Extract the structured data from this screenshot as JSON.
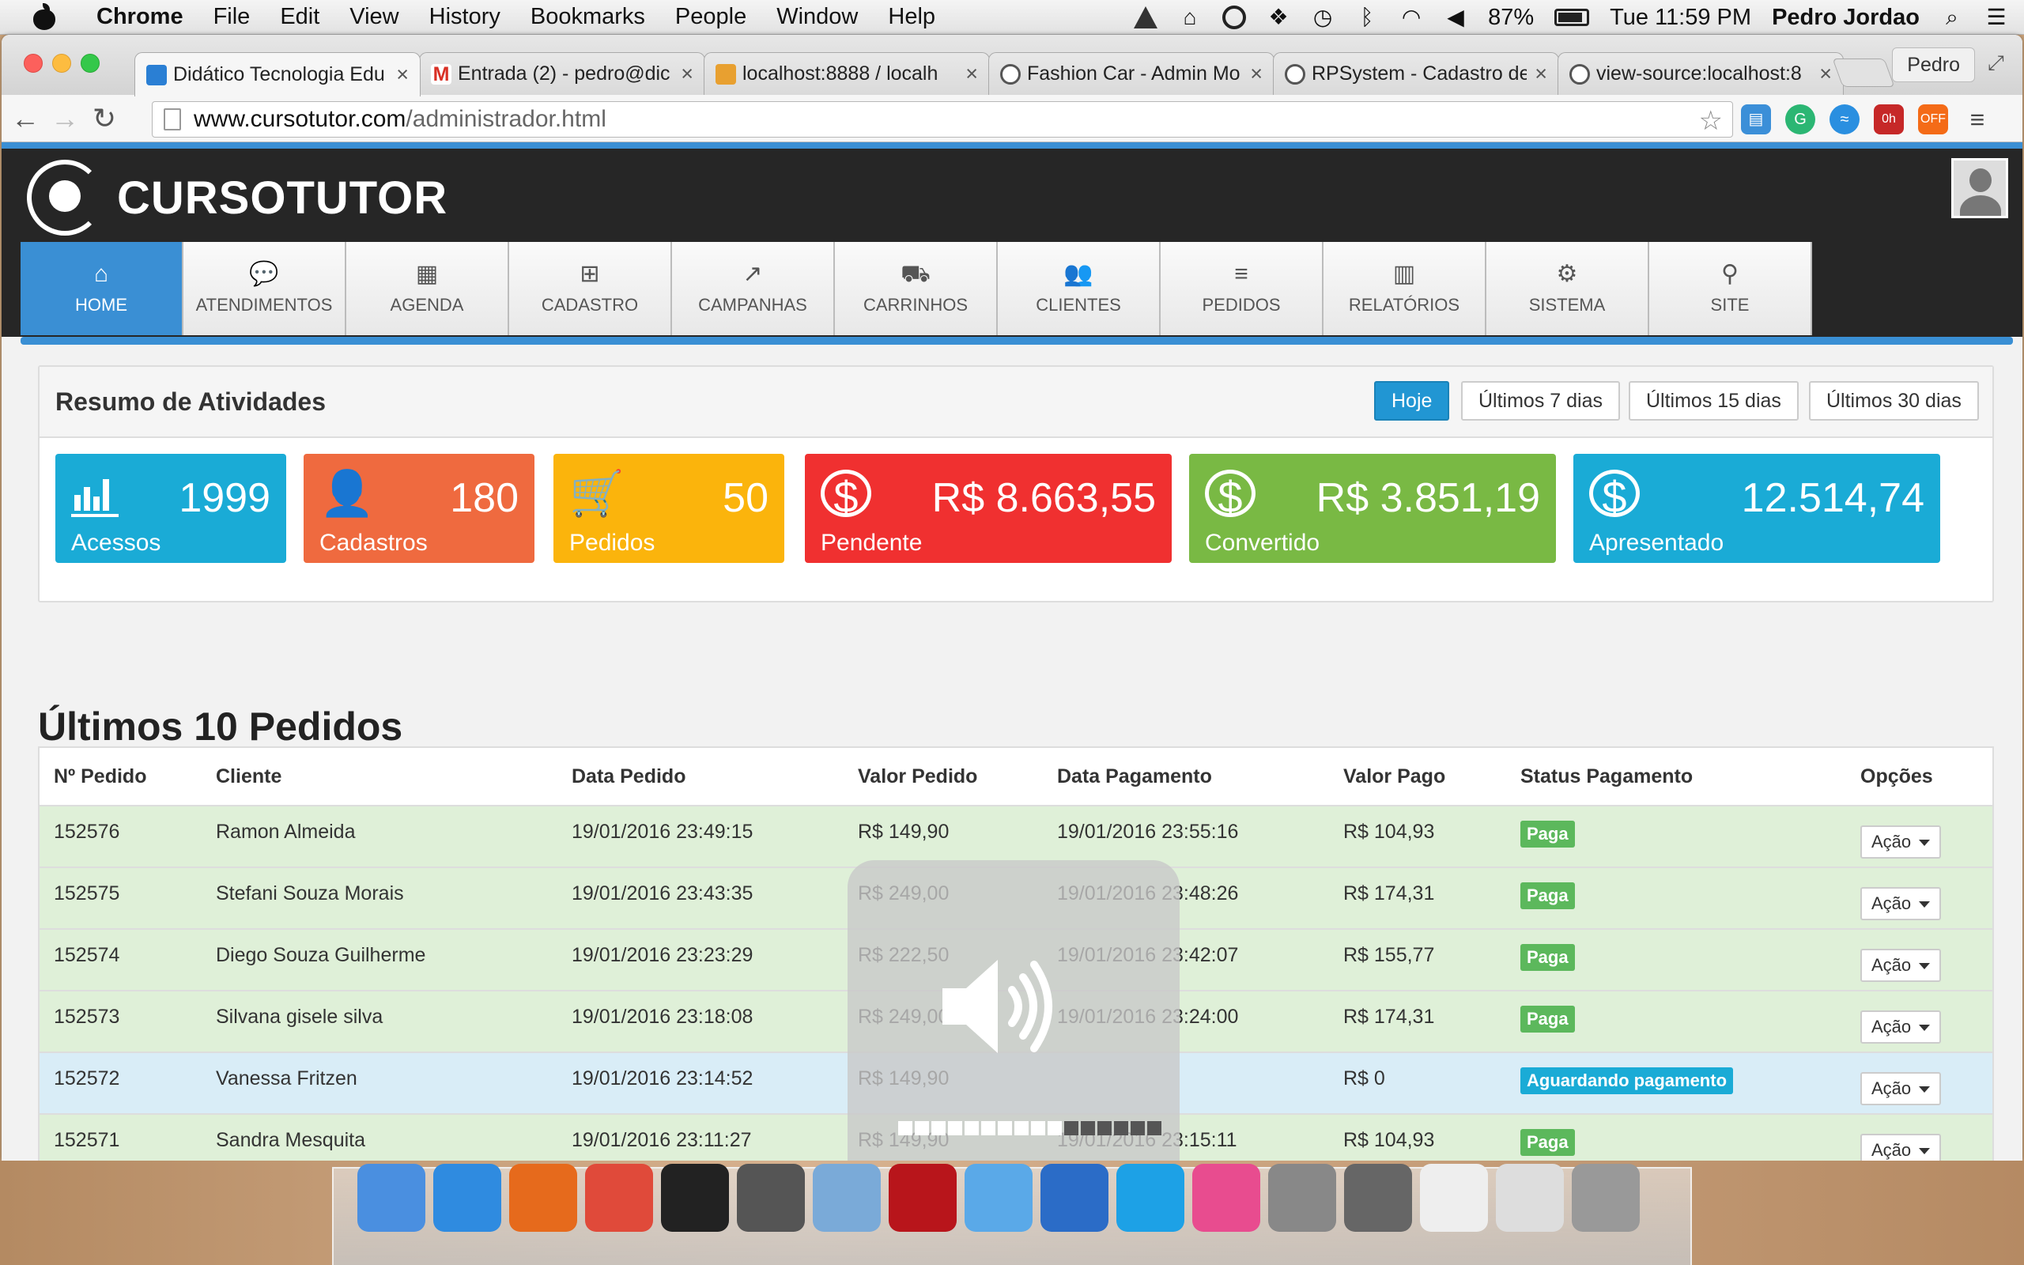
{
  "menubar": {
    "app": "Chrome",
    "items": [
      "File",
      "Edit",
      "View",
      "History",
      "Bookmarks",
      "People",
      "Window",
      "Help"
    ],
    "battery": "87%",
    "clock": "Tue 11:59 PM",
    "user": "Pedro Jordao"
  },
  "browser": {
    "tabs": [
      {
        "title": "Didático Tecnologia Edu"
      },
      {
        "title": "Entrada (2) - pedro@dic"
      },
      {
        "title": "localhost:8888 / localh"
      },
      {
        "title": "Fashion Car - Admin Mo"
      },
      {
        "title": "RPSystem - Cadastro de"
      },
      {
        "title": "view-source:localhost:8"
      }
    ],
    "profile": "Pedro",
    "url_host": "www.cursotutor.com",
    "url_path": "/administrador.html"
  },
  "site": {
    "brand": "CURSOTUTOR",
    "nav": [
      {
        "label": "HOME",
        "icon": "home-icon",
        "glyph": "⌂"
      },
      {
        "label": "ATENDIMENTOS",
        "icon": "chat-icon",
        "glyph": "💬"
      },
      {
        "label": "AGENDA",
        "icon": "calendar-icon",
        "glyph": "▦"
      },
      {
        "label": "CADASTRO",
        "icon": "plus-square-icon",
        "glyph": "⊞"
      },
      {
        "label": "CAMPANHAS",
        "icon": "chart-line-icon",
        "glyph": "↗"
      },
      {
        "label": "CARRINHOS",
        "icon": "cart-icon",
        "glyph": "⛟"
      },
      {
        "label": "CLIENTES",
        "icon": "users-icon",
        "glyph": "👥"
      },
      {
        "label": "PEDIDOS",
        "icon": "list-icon",
        "glyph": "≡"
      },
      {
        "label": "RELATÓRIOS",
        "icon": "bar-chart-icon",
        "glyph": "▥"
      },
      {
        "label": "SISTEMA",
        "icon": "gears-icon",
        "glyph": "⚙"
      },
      {
        "label": "SITE",
        "icon": "map-marker-icon",
        "glyph": "⚲"
      }
    ]
  },
  "resumo": {
    "title": "Resumo de Atividades",
    "filters": [
      "Hoje",
      "Últimos 7 dias",
      "Últimos 15 dias",
      "Últimos 30 dias"
    ],
    "cards": [
      {
        "value": "1999",
        "label": "Acessos",
        "color": "#1aabd6",
        "icon": "bar-chart-icon"
      },
      {
        "value": "180",
        "label": "Cadastros",
        "color": "#ef6a3f",
        "icon": "user-icon"
      },
      {
        "value": "50",
        "label": "Pedidos",
        "color": "#fbb40c",
        "icon": "cart-icon"
      },
      {
        "value": "R$ 8.663,55",
        "label": "Pendente",
        "color": "#f03030",
        "icon": "dollar-icon"
      },
      {
        "value": "R$ 3.851,19",
        "label": "Convertido",
        "color": "#79b944",
        "icon": "dollar-icon"
      },
      {
        "value": "12.514,74",
        "label": "Apresentado",
        "color": "#1aabd6",
        "icon": "dollar-icon"
      }
    ]
  },
  "pedidos": {
    "title": "Últimos 10 Pedidos",
    "columns": [
      "Nº Pedido",
      "Cliente",
      "Data Pedido",
      "Valor Pedido",
      "Data Pagamento",
      "Valor Pago",
      "Status Pagamento",
      "Opções"
    ],
    "action_label": "Ação",
    "rows": [
      {
        "id": "152576",
        "cliente": "Ramon Almeida",
        "data": "19/01/2016 23:49:15",
        "valor": "R$ 149,90",
        "pagamento": "19/01/2016 23:55:16",
        "pago": "R$ 104,93",
        "status": "Paga",
        "state": "paid"
      },
      {
        "id": "152575",
        "cliente": "Stefani Souza Morais",
        "data": "19/01/2016 23:43:35",
        "valor": "R$ 249,00",
        "pagamento": "19/01/2016 23:48:26",
        "pago": "R$ 174,31",
        "status": "Paga",
        "state": "paid"
      },
      {
        "id": "152574",
        "cliente": "Diego Souza Guilherme",
        "data": "19/01/2016 23:23:29",
        "valor": "R$ 222,50",
        "pagamento": "19/01/2016 23:42:07",
        "pago": "R$ 155,77",
        "status": "Paga",
        "state": "paid"
      },
      {
        "id": "152573",
        "cliente": "Silvana gisele silva",
        "data": "19/01/2016 23:18:08",
        "valor": "R$ 249,00",
        "pagamento": "19/01/2016 23:24:00",
        "pago": "R$ 174,31",
        "status": "Paga",
        "state": "paid"
      },
      {
        "id": "152572",
        "cliente": "Vanessa Fritzen",
        "data": "19/01/2016 23:14:52",
        "valor": "R$ 149,90",
        "pagamento": "",
        "pago": "R$ 0",
        "status": "Aguardando pagamento",
        "state": "waiting"
      },
      {
        "id": "152571",
        "cliente": "Sandra Mesquita",
        "data": "19/01/2016 23:11:27",
        "valor": "R$ 149,90",
        "pagamento": "19/01/2016 23:15:11",
        "pago": "R$ 104,93",
        "status": "Paga",
        "state": "paid"
      }
    ]
  },
  "volume_overlay": {
    "level_fraction": 0.62
  },
  "dock": {
    "apps": [
      "finder-icon",
      "safari-icon",
      "firefox-icon",
      "chrome-icon",
      "terminal-icon",
      "sublime-icon",
      "virtualbox-icon",
      "filezilla-icon",
      "messages-icon",
      "thunderbird-icon",
      "skype-icon",
      "itunes-icon",
      "system-preferences-icon",
      "sequel-pro-icon",
      "textedit-icon",
      "preview-icon",
      "trash-icon"
    ],
    "colors": [
      "#4a8fe0",
      "#2f8be0",
      "#e66a1c",
      "#e04a3a",
      "#222222",
      "#555555",
      "#7aaad8",
      "#b8151b",
      "#5aa9e8",
      "#2b6cc7",
      "#1da1e6",
      "#e84c8f",
      "#888888",
      "#666666",
      "#eeeeee",
      "#dddddd",
      "#999999"
    ]
  }
}
